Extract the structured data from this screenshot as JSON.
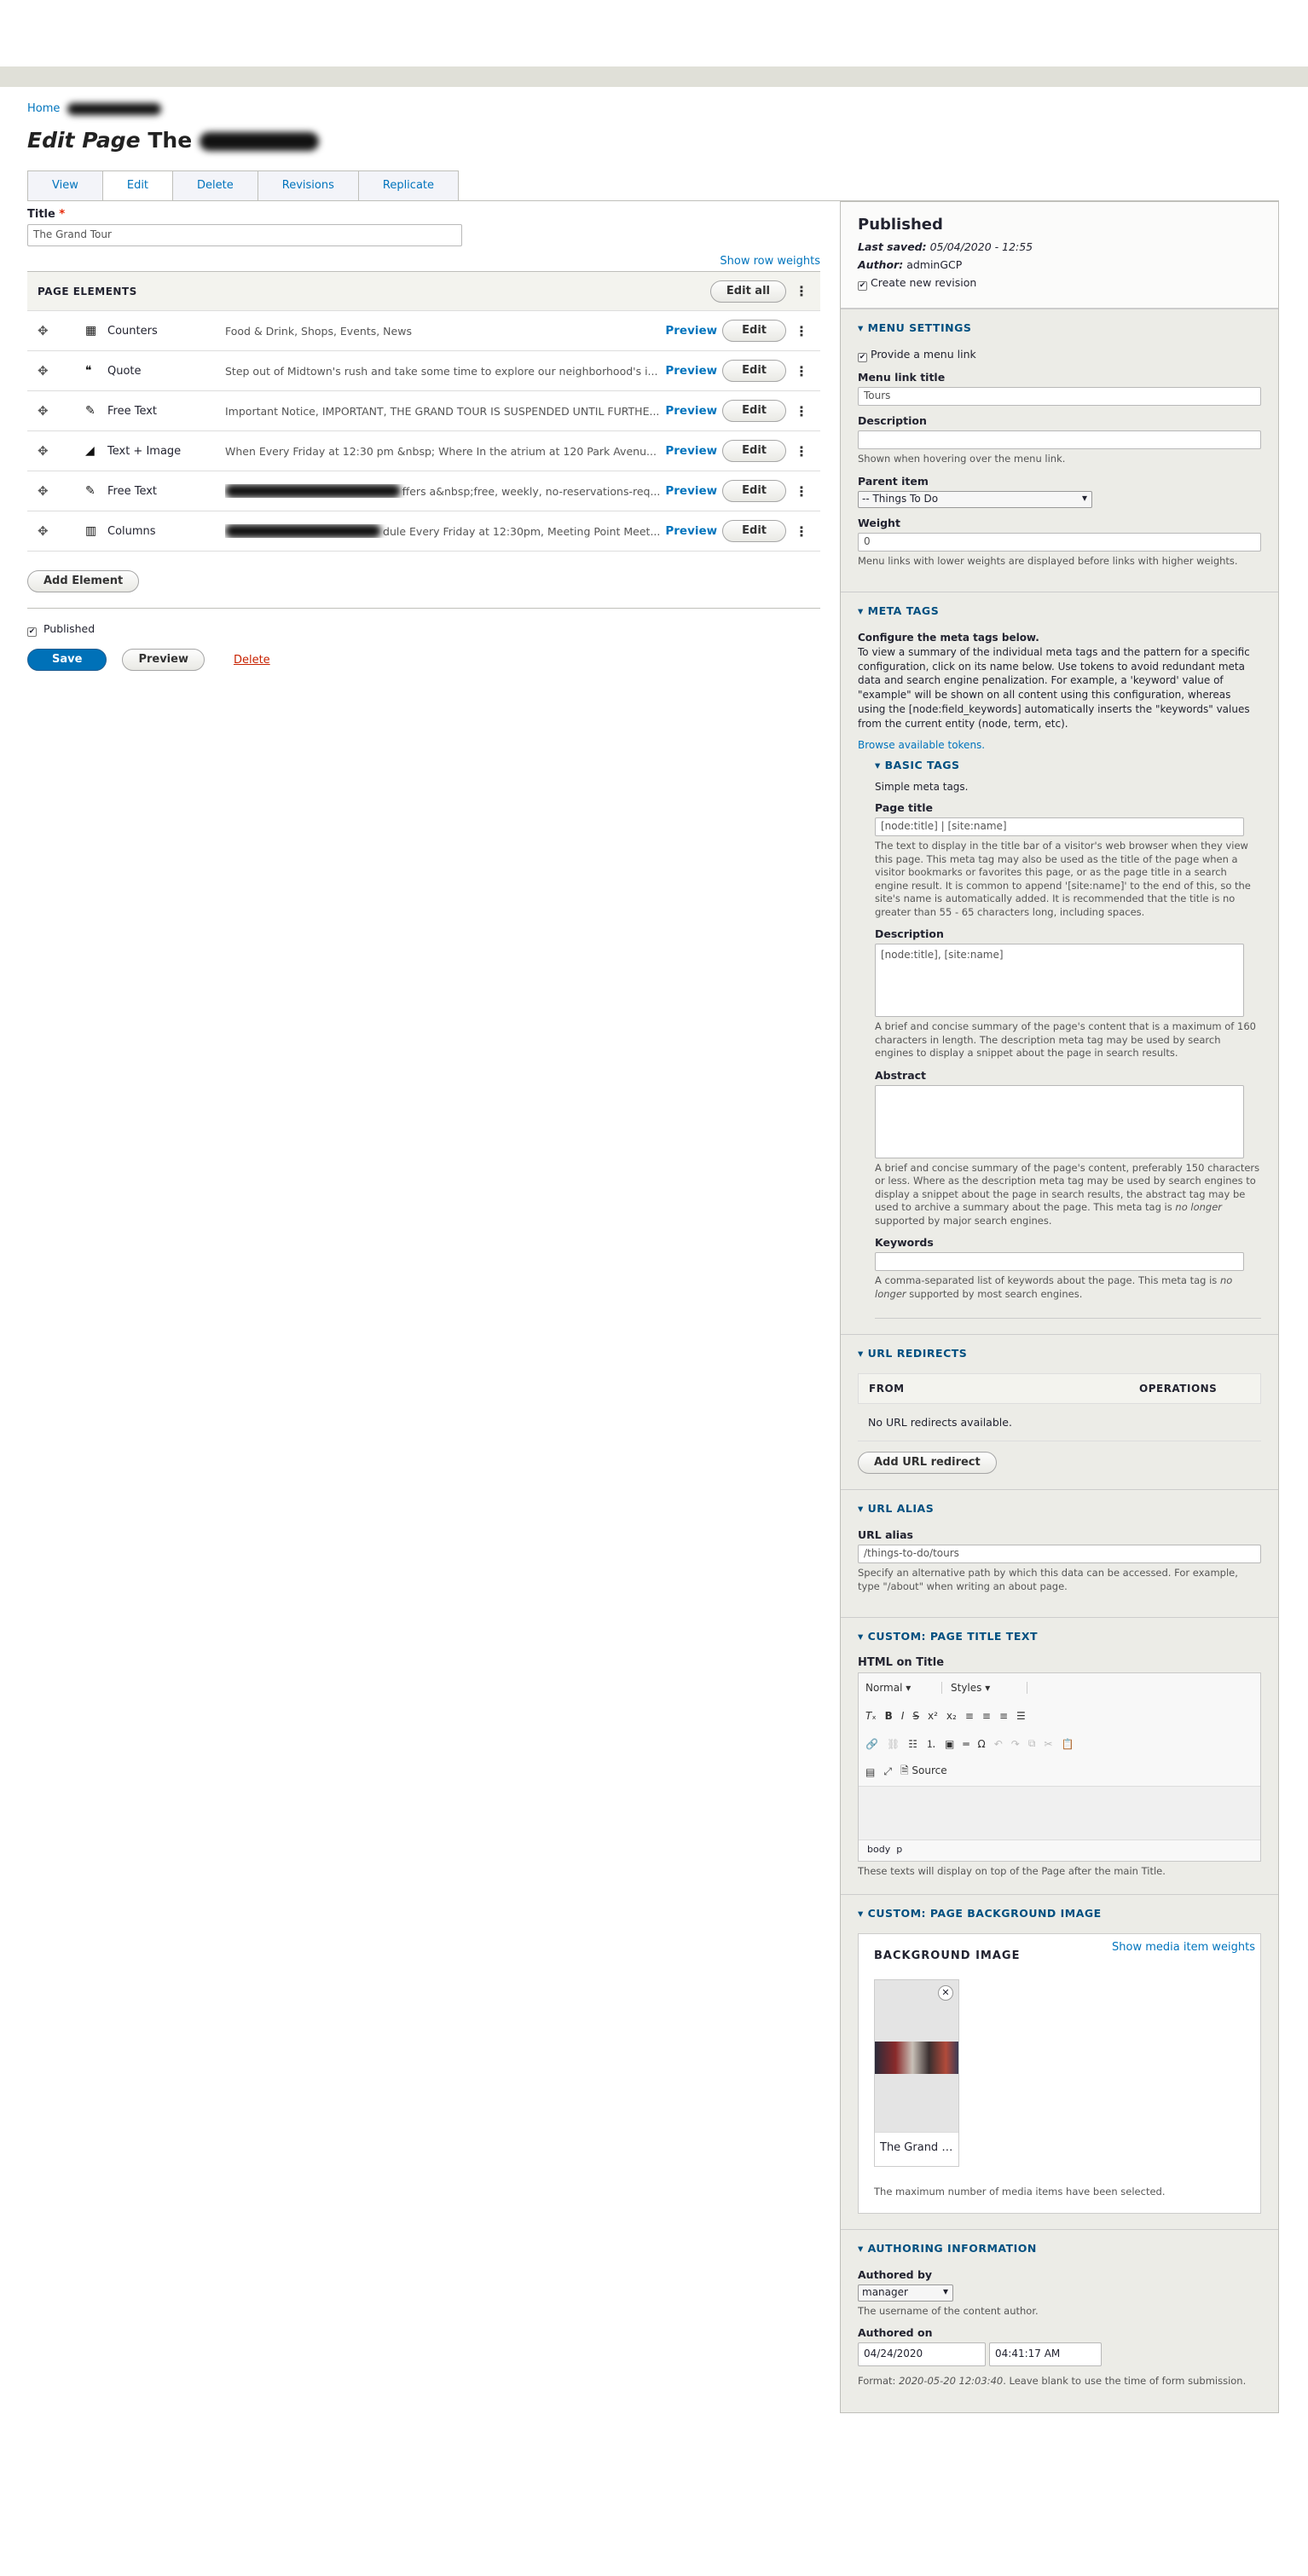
{
  "breadcrumb": {
    "home": "Home"
  },
  "page_title": {
    "prefix": "Edit Page",
    "name": "The"
  },
  "tabs": [
    "View",
    "Edit",
    "Delete",
    "Revisions",
    "Replicate"
  ],
  "title_field": {
    "label": "Title",
    "required_mark": "*",
    "value": "The Grand Tour"
  },
  "show_row_weights": "Show row weights",
  "page_elements": {
    "header": "PAGE ELEMENTS",
    "edit_all": "Edit all",
    "preview_label": "Preview",
    "edit_label": "Edit",
    "rows": [
      {
        "icon": "counters-icon",
        "type": "Counters",
        "summary": "Food & Drink, Shops, Events, News"
      },
      {
        "icon": "quote-icon",
        "type": "Quote",
        "summary": "Step out of Midtown's rush and take some time to explore our neighborhood's i..."
      },
      {
        "icon": "pencil-icon",
        "type": "Free Text",
        "summary": "Important Notice, IMPORTANT, THE GRAND TOUR IS SUSPENDED UNTIL FURTHE..."
      },
      {
        "icon": "text-image-icon",
        "type": "Text + Image",
        "summary": "When Every Friday at 12:30 pm &nbsp; Where In the atrium at 120 Park Avenu..."
      },
      {
        "icon": "pencil-icon",
        "type": "Free Text",
        "summary": "ffers a&nbsp;free, weekly, no-reservations-req..."
      },
      {
        "icon": "columns-icon",
        "type": "Columns",
        "summary": "dule Every Friday at 12:30pm, Meeting Point Meet..."
      }
    ]
  },
  "add_element": "Add Element",
  "published_label": "Published",
  "actions": {
    "save": "Save",
    "preview": "Preview",
    "delete": "Delete"
  },
  "meta": {
    "status": "Published",
    "last_saved_label": "Last saved:",
    "last_saved_value": "05/04/2020 - 12:55",
    "author_label": "Author:",
    "author_value": "adminGCP",
    "create_revision": "Create new revision"
  },
  "menu_settings": {
    "title": "MENU SETTINGS",
    "provide_link": "Provide a menu link",
    "link_title_label": "Menu link title",
    "link_title_value": "Tours",
    "description_label": "Description",
    "description_help": "Shown when hovering over the menu link.",
    "parent_label": "Parent item",
    "parent_value": "-- Things To Do",
    "weight_label": "Weight",
    "weight_value": "0",
    "weight_help": "Menu links with lower weights are displayed before links with higher weights."
  },
  "meta_tags": {
    "title": "META TAGS",
    "intro_bold": "Configure the meta tags below.",
    "intro": "To view a summary of the individual meta tags and the pattern for a specific configuration, click on its name below. Use tokens to avoid redundant meta data and search engine penalization. For example, a 'keyword' value of \"example\" will be shown on all content using this configuration, whereas using the [node:field_keywords] automatically inserts the \"keywords\" values from the current entity (node, term, etc).",
    "browse_tokens": "Browse available tokens.",
    "basic_tags_title": "BASIC TAGS",
    "basic_tags_desc": "Simple meta tags.",
    "page_title_label": "Page title",
    "page_title_value": "[node:title] | [site:name]",
    "page_title_help": "The text to display in the title bar of a visitor's web browser when they view this page. This meta tag may also be used as the title of the page when a visitor bookmarks or favorites this page, or as the page title in a search engine result. It is common to append '[site:name]' to the end of this, so the site's name is automatically added. It is recommended that the title is no greater than 55 - 65 characters long, including spaces.",
    "description_label": "Description",
    "description_value": "[node:title], [site:name]",
    "description_help": "A brief and concise summary of the page's content that is a maximum of 160 characters in length. The description meta tag may be used by search engines to display a snippet about the page in search results.",
    "abstract_label": "Abstract",
    "abstract_help_1": "A brief and concise summary of the page's content, preferably 150 characters or less. Where as the description meta tag may be used by search engines to display a snippet about the page in search results, the abstract tag may be used to archive a summary about the page. This meta tag is ",
    "abstract_help_em": "no longer",
    "abstract_help_2": " supported by major search engines.",
    "keywords_label": "Keywords",
    "keywords_help_1": "A comma-separated list of keywords about the page. This meta tag is ",
    "keywords_help_em": "no longer",
    "keywords_help_2": " supported by most search engines."
  },
  "url_redirects": {
    "title": "URL REDIRECTS",
    "col_from": "FROM",
    "col_operations": "OPERATIONS",
    "empty": "No URL redirects available.",
    "add_button": "Add URL redirect"
  },
  "url_alias": {
    "title": "URL ALIAS",
    "label": "URL alias",
    "value": "/things-to-do/tours",
    "help": "Specify an alternative path by which this data can be accessed. For example, type \"/about\" when writing an about page."
  },
  "page_title_text": {
    "title": "CUSTOM: PAGE TITLE TEXT",
    "label": "HTML on Title",
    "format_value": "Normal",
    "styles_value": "Styles",
    "source_label": "Source",
    "path_body": "body",
    "path_p": "p",
    "help": "These texts will display on top of the Page after the main Title."
  },
  "background_image": {
    "title": "CUSTOM: PAGE BACKGROUND IMAGE",
    "box_title": "BACKGROUND IMAGE",
    "weights_link": "Show media item weights",
    "media_name": "The Grand Tour",
    "max_note": "The maximum number of media items have been selected."
  },
  "authoring": {
    "title": "AUTHORING INFORMATION",
    "authored_by_label": "Authored by",
    "authored_by_value": "manager",
    "authored_by_help": "The username of the content author.",
    "authored_on_label": "Authored on",
    "date_value": "04/24/2020",
    "time_value": "04:41:17 AM",
    "format_label": "Format: ",
    "format_example": "2020-05-20 12:03:40",
    "format_help": ". Leave blank to use the time of form submission."
  }
}
